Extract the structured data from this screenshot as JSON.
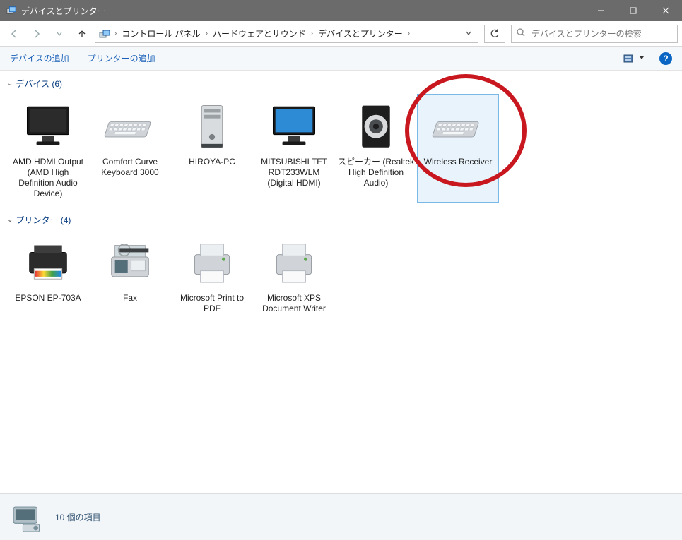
{
  "window": {
    "title": "デバイスとプリンター"
  },
  "breadcrumb": {
    "items": [
      "コントロール パネル",
      "ハードウェアとサウンド",
      "デバイスとプリンター"
    ]
  },
  "search": {
    "placeholder": "デバイスとプリンターの検索"
  },
  "toolbar": {
    "add_device": "デバイスの追加",
    "add_printer": "プリンターの追加"
  },
  "groups": [
    {
      "name": "デバイス",
      "count_label": "デバイス (6)",
      "items": [
        {
          "label": "AMD HDMI Output (AMD High Definition Audio Device)",
          "icon": "monitor"
        },
        {
          "label": "Comfort Curve Keyboard 3000",
          "icon": "keyboard"
        },
        {
          "label": "HIROYA-PC",
          "icon": "tower"
        },
        {
          "label": "MITSUBISHI TFT RDT233WLM (Digital HDMI)",
          "icon": "monitor-blue"
        },
        {
          "label": "スピーカー (Realtek High Definition Audio)",
          "icon": "speaker"
        },
        {
          "label": "Wireless Receiver",
          "icon": "keyboard",
          "selected": true
        }
      ]
    },
    {
      "name": "プリンター",
      "count_label": "プリンター (4)",
      "items": [
        {
          "label": "EPSON EP-703A",
          "icon": "printer-ink"
        },
        {
          "label": "Fax",
          "icon": "fax"
        },
        {
          "label": "Microsoft Print to PDF",
          "icon": "printer"
        },
        {
          "label": "Microsoft XPS Document Writer",
          "icon": "printer"
        }
      ]
    }
  ],
  "status": {
    "text": "10 個の項目"
  },
  "annotation": {
    "circled_item": "Wireless Receiver"
  }
}
